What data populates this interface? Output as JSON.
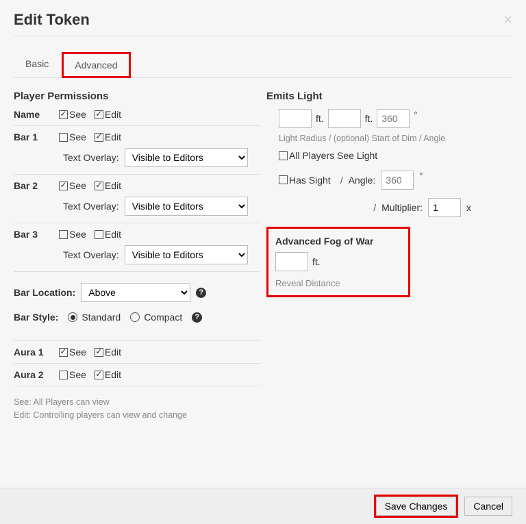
{
  "header": {
    "title": "Edit Token",
    "close_glyph": "×"
  },
  "tabs": {
    "basic": "Basic",
    "advanced": "Advanced"
  },
  "permissions": {
    "title": "Player Permissions",
    "see": "See",
    "edit": "Edit",
    "name_label": "Name",
    "bar1_label": "Bar 1",
    "bar2_label": "Bar 2",
    "bar3_label": "Bar 3",
    "overlay_label": "Text Overlay:",
    "overlay_value": "Visible to Editors",
    "bar_location_label": "Bar Location:",
    "bar_location_value": "Above",
    "bar_style_label": "Bar Style:",
    "style_standard": "Standard",
    "style_compact": "Compact",
    "aura1_label": "Aura 1",
    "aura2_label": "Aura 2",
    "hint_see": "See: All Players can view",
    "hint_edit": "Edit: Controlling players can view and change",
    "help_glyph": "?"
  },
  "light": {
    "title": "Emits Light",
    "ft": "ft.",
    "angle_placeholder": "360",
    "degree": "°",
    "radius_hint": "Light Radius / (optional) Start of Dim / Angle",
    "all_players": "All Players See Light",
    "has_sight": "Has Sight",
    "slash": "/",
    "angle_label": "Angle:",
    "multiplier_label": "Multiplier:",
    "multiplier_value": "1",
    "x": "x"
  },
  "fog": {
    "title": "Advanced Fog of War",
    "ft": "ft.",
    "hint": "Reveal Distance"
  },
  "footer": {
    "save": "Save Changes",
    "cancel": "Cancel"
  }
}
